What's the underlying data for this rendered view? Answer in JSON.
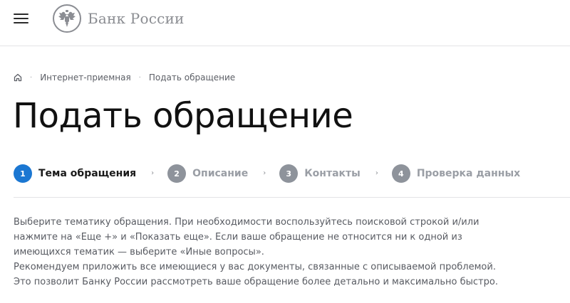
{
  "header": {
    "menu_icon": "hamburger-menu-icon",
    "logo_emblem": "double-headed-eagle-emblem",
    "logo_text": "Банк России"
  },
  "breadcrumb": {
    "home_icon": "home-icon",
    "items": [
      "Интернет-приемная",
      "Подать обращение"
    ],
    "separator": "·"
  },
  "page": {
    "title": "Подать обращение"
  },
  "steps": [
    {
      "number": "1",
      "label": "Тема обращения",
      "state": "active"
    },
    {
      "number": "2",
      "label": "Описание",
      "state": "inactive"
    },
    {
      "number": "3",
      "label": "Контакты",
      "state": "inactive"
    },
    {
      "number": "4",
      "label": "Проверка данных",
      "state": "inactive"
    }
  ],
  "step_arrow": "›",
  "description": {
    "paragraph1": "Выберите тематику обращения. При необходимости воспользуйтесь поисковой строкой и/или нажмите на «Еще +» и «Показать еще». Если ваше обращение не относится ни к одной из имеющихся тематик — выберите «Иные вопросы».",
    "paragraph2": "Рекомендуем приложить все имеющиеся у вас документы, связанные с описываемой проблемой. Это позволит Банку России рассмотреть ваше обращение более детально и максимально быстро."
  },
  "colors": {
    "accent": "#1b77d2",
    "inactive_step": "#8e939b",
    "text": "#1f1f1f",
    "muted_text": "#585b62"
  }
}
